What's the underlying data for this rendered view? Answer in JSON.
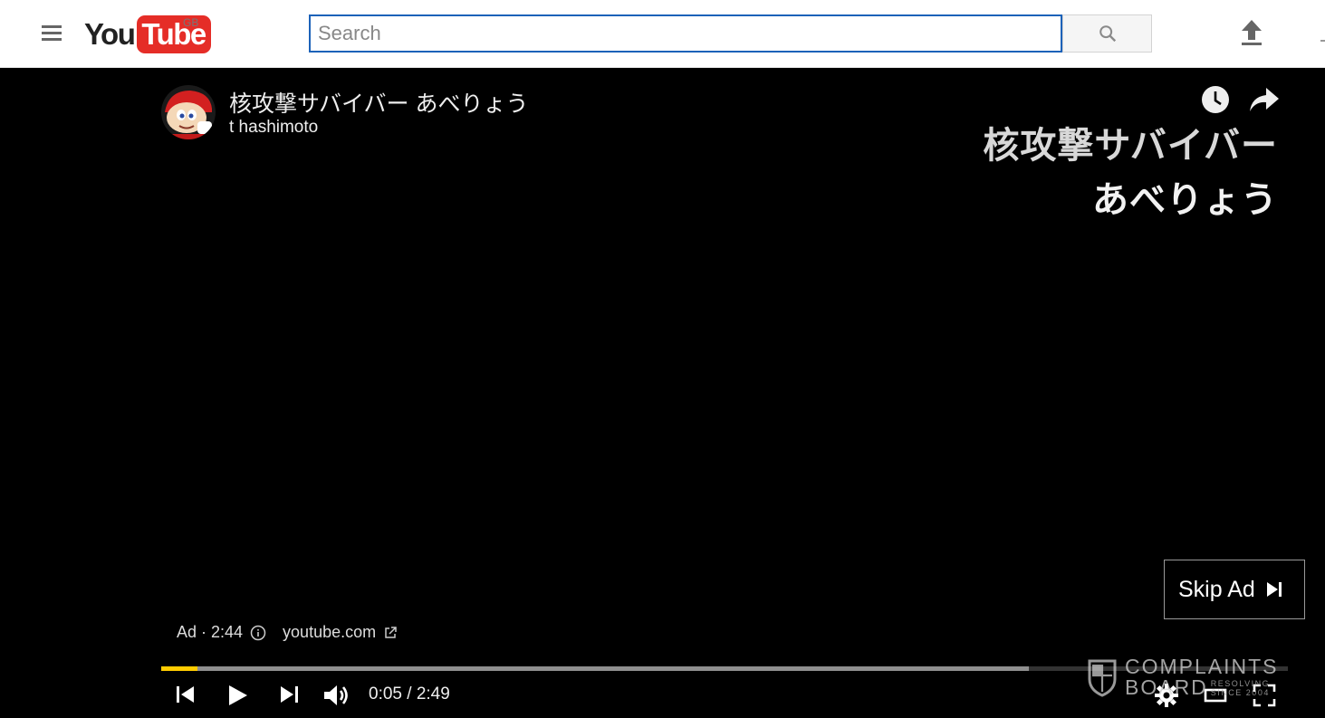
{
  "masthead": {
    "logo_you": "You",
    "logo_tube": "Tube",
    "region": "GB",
    "search_placeholder": "Search",
    "search_value": ""
  },
  "player": {
    "video_title": "核攻撃サバイバー あべりょう",
    "channel_name": "t hashimoto",
    "overlay_title_line1": "核攻撃サバイバー",
    "overlay_title_line2": "あべりょう",
    "skip_ad_label": "Skip Ad",
    "ad_countdown": "Ad · 2:44",
    "ad_link": "youtube.com",
    "current_time": "0:05",
    "duration": "2:49",
    "time_display": "0:05 / 2:49",
    "progress_played_fraction": 0.032,
    "progress_loaded_fraction": 0.77,
    "accent_color": "#ffcc00"
  },
  "watermark": {
    "line1": "COMPLAINTS",
    "line2": "BOARD",
    "tag_line1": "RESOLVING",
    "tag_line2": "SINCE 2004"
  },
  "icons": [
    "menu-icon",
    "search-icon",
    "upload-icon",
    "watch-later-icon",
    "share-icon",
    "skip-next-icon",
    "info-icon",
    "external-link-icon",
    "previous-icon",
    "play-icon",
    "next-icon",
    "volume-icon",
    "settings-icon",
    "theater-mode-icon",
    "fullscreen-icon",
    "shield-icon"
  ]
}
